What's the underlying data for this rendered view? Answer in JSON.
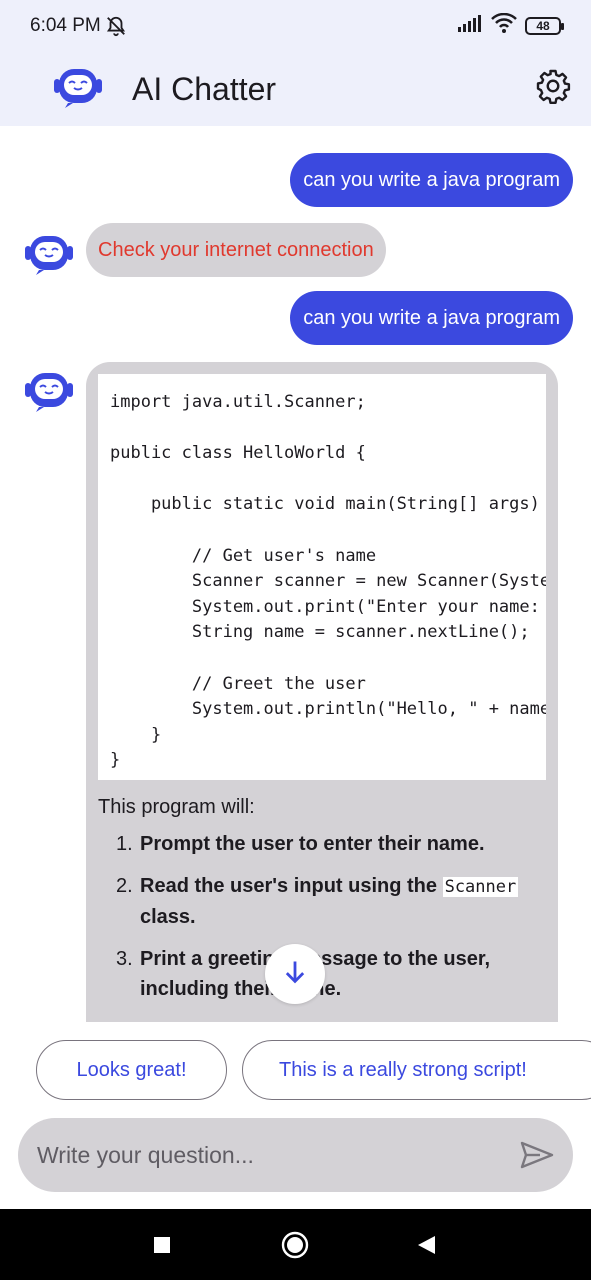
{
  "status_bar": {
    "time": "6:04 PM",
    "battery": "48"
  },
  "app_bar": {
    "title": "AI Chatter"
  },
  "messages": {
    "user_1": "can you write a java program",
    "bot_error": "Check your internet connection",
    "user_2": "can you write a java program",
    "bot_code": [
      "import java.util.Scanner;",
      "",
      "public class HelloWorld {",
      "",
      "    public static void main(String[] args) {",
      "",
      "        // Get user's name",
      "        Scanner scanner = new Scanner(System.in);",
      "        System.out.print(\"Enter your name: \");",
      "        String name = scanner.nextLine();",
      "",
      "        // Greet the user",
      "        System.out.println(\"Hello, \" + name);",
      "    }",
      "}"
    ],
    "bot_intro": "This program will:",
    "bot_steps": {
      "s1_num": "1.",
      "s1_text": "Prompt the user to enter their name.",
      "s2_num": "2.",
      "s2_before": "Read the user's input using the ",
      "s2_code": "Scanner",
      "s2_after": "class.",
      "s3_num": "3.",
      "s3_text": "Print a greeting message to the user, including their name."
    }
  },
  "suggestions": [
    "Looks great!",
    "This is a really strong script!"
  ],
  "input": {
    "placeholder": "Write your question..."
  },
  "colors": {
    "user_bubble": "#3b49df",
    "bot_bubble": "#d4d2d6",
    "error_text": "#e0392e",
    "accent": "#3b49df"
  },
  "icons": {
    "avatar": "robot-icon",
    "settings": "gear-icon",
    "send": "send-icon",
    "scroll": "arrow-down-icon"
  }
}
